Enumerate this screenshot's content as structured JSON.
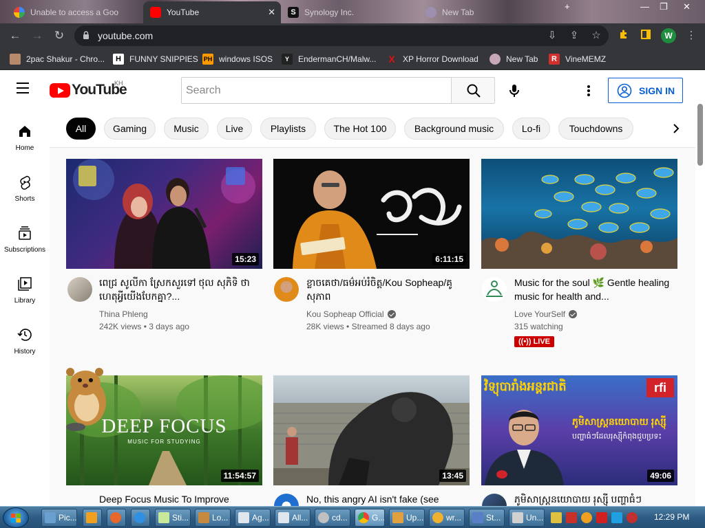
{
  "browser": {
    "tabs": [
      {
        "title": "Unable to access a Goo",
        "active": false
      },
      {
        "title": "YouTube",
        "active": true
      },
      {
        "title": "Synology Inc.",
        "active": false
      },
      {
        "title": "New Tab",
        "active": false
      }
    ],
    "url": "youtube.com",
    "profile_initial": "W",
    "bookmarks": [
      {
        "label": "2pac Shakur - Chro...",
        "icon": "2pac-icon"
      },
      {
        "label": "FUNNY SNIPPIES",
        "icon": "h-icon"
      },
      {
        "label": "windows ISOS",
        "icon": "ph-icon"
      },
      {
        "label": "EndermanCH/Malw...",
        "icon": "yp-icon"
      },
      {
        "label": "XP Horror Download",
        "icon": "x-icon"
      },
      {
        "label": "New Tab",
        "icon": "new-tab-icon"
      },
      {
        "label": "VineMEMZ",
        "icon": "r-icon"
      }
    ]
  },
  "youtube": {
    "logo_text": "YouTube",
    "country_code": "KH",
    "search_placeholder": "Search",
    "signin_label": "SIGN IN",
    "guide": [
      {
        "label": "Home",
        "icon": "home-icon"
      },
      {
        "label": "Shorts",
        "icon": "shorts-icon"
      },
      {
        "label": "Subscriptions",
        "icon": "subscriptions-icon"
      },
      {
        "label": "Library",
        "icon": "library-icon"
      },
      {
        "label": "History",
        "icon": "history-icon"
      }
    ],
    "chips": [
      "All",
      "Gaming",
      "Music",
      "Live",
      "Playlists",
      "The Hot 100",
      "Background music",
      "Lo-fi",
      "Touchdowns"
    ],
    "videos": [
      {
        "title": "ពេជ្រ សូលីកា ស្រែកសួរទៅ ថុល សុភិទិ ថា ហេតុអ្វីយើងបែកគ្នា?...",
        "channel": "Thina Phleng",
        "verified": false,
        "views": "242K views",
        "age": "3 days ago",
        "duration": "15:23"
      },
      {
        "title": "ខ្លាចគេថា/ធម៌អប់រំចិត្ត/Kou Sopheap/គូ សុភាព",
        "channel": "Kou Sopheap Official",
        "verified": true,
        "views": "28K views",
        "age": "Streamed 8 days ago",
        "duration": "6:11:15"
      },
      {
        "title": "Music for the soul 🌿 Gentle healing music for health and...",
        "channel": "Love YourSelf",
        "verified": true,
        "views": "315 watching",
        "age": "",
        "live_badge": "LIVE",
        "duration": ""
      },
      {
        "title": "Deep Focus Music To Improve",
        "thumb_text": "DEEP FOCUS",
        "thumb_subtext": "MUSIC FOR STUDYING",
        "duration": "11:54:57"
      },
      {
        "title": "No, this angry AI isn't fake (see",
        "duration": "13:45"
      },
      {
        "title": "ភូមិសាស្ត្រនយោបាយ រុស្ស៊ី បញ្ហាធំៗ",
        "thumb_text": "វិទ្យុបារាំងអន្តរជាតិ",
        "thumb_logo": "rfi",
        "thumb_caption": "ភូមិសាស្ត្រនយោបាយ រុស្ស៊ី",
        "thumb_caption2": "បញ្ហាធំៗដែលរុស្ស៊ីកំពុងជួបប្រទះ",
        "duration": "49:06"
      }
    ]
  },
  "taskbar": {
    "tasks": [
      "Pic...",
      "",
      "",
      "",
      "Sti...",
      "Lo...",
      "Ag...",
      "All...",
      "cd...",
      "G...",
      "Up...",
      "wr...",
      "St...",
      "Un..."
    ],
    "clock": "12:29 PM"
  },
  "colors": {
    "yt_red": "#ff0000",
    "signin_blue": "#065fd4",
    "live_red": "#cc0000",
    "chrome_dark": "#35363a"
  }
}
